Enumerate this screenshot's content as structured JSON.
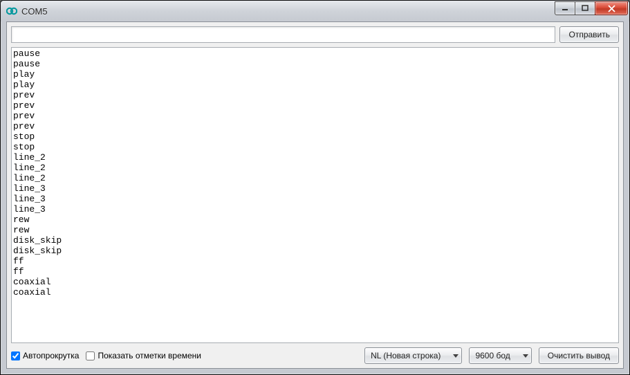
{
  "window": {
    "title": "COM5",
    "icon": "arduino-icon"
  },
  "toolbar": {
    "input_value": "",
    "input_placeholder": "",
    "send_label": "Отправить"
  },
  "output_lines": [
    "pause",
    "pause",
    "play",
    "play",
    "prev",
    "prev",
    "prev",
    "prev",
    "stop",
    "stop",
    "line_2",
    "line_2",
    "line_2",
    "line_3",
    "line_3",
    "line_3",
    "rew",
    "rew",
    "disk_skip",
    "disk_skip",
    "ff",
    "ff",
    "coaxial",
    "coaxial"
  ],
  "footer": {
    "autoscroll_checked": true,
    "autoscroll_label": "Автопрокрутка",
    "timestamps_checked": false,
    "timestamps_label": "Показать отметки времени",
    "line_ending_selected": "NL (Новая строка)",
    "baud_selected": "9600 бод",
    "clear_label": "Очистить вывод"
  }
}
